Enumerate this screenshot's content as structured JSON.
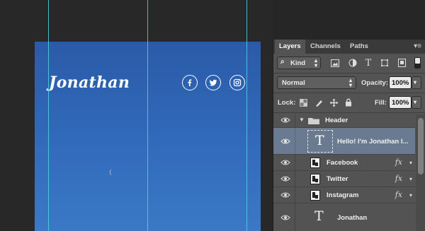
{
  "canvas": {
    "brand": "Jonathan",
    "social_icons": [
      "facebook-icon",
      "twitter-icon",
      "instagram-icon"
    ]
  },
  "panel": {
    "tabs": [
      {
        "label": "Layers",
        "active": true
      },
      {
        "label": "Channels",
        "active": false
      },
      {
        "label": "Paths",
        "active": false
      }
    ],
    "filter": {
      "kind_label": "Kind"
    },
    "blend_mode": "Normal",
    "opacity_label": "Opacity:",
    "opacity_value": "100%",
    "lock_label": "Lock:",
    "fill_label": "Fill:",
    "fill_value": "100%",
    "layers": [
      {
        "name": "Header",
        "type": "group",
        "expanded": true
      },
      {
        "name": "Hello! I'm Jonathan I...",
        "type": "text",
        "selected": true
      },
      {
        "name": "Facebook",
        "type": "smart-object",
        "fx": "fx"
      },
      {
        "name": "Twitter",
        "type": "smart-object",
        "fx": "fx"
      },
      {
        "name": "Instagram",
        "type": "smart-object",
        "fx": "fx"
      },
      {
        "name": "Jonathan",
        "type": "text"
      }
    ]
  },
  "colors": {
    "guide": "#4fd3e0",
    "sky_top": "#2a5ba8",
    "sky_bottom": "#3a79c6",
    "selected_layer": "#6a7a90"
  }
}
